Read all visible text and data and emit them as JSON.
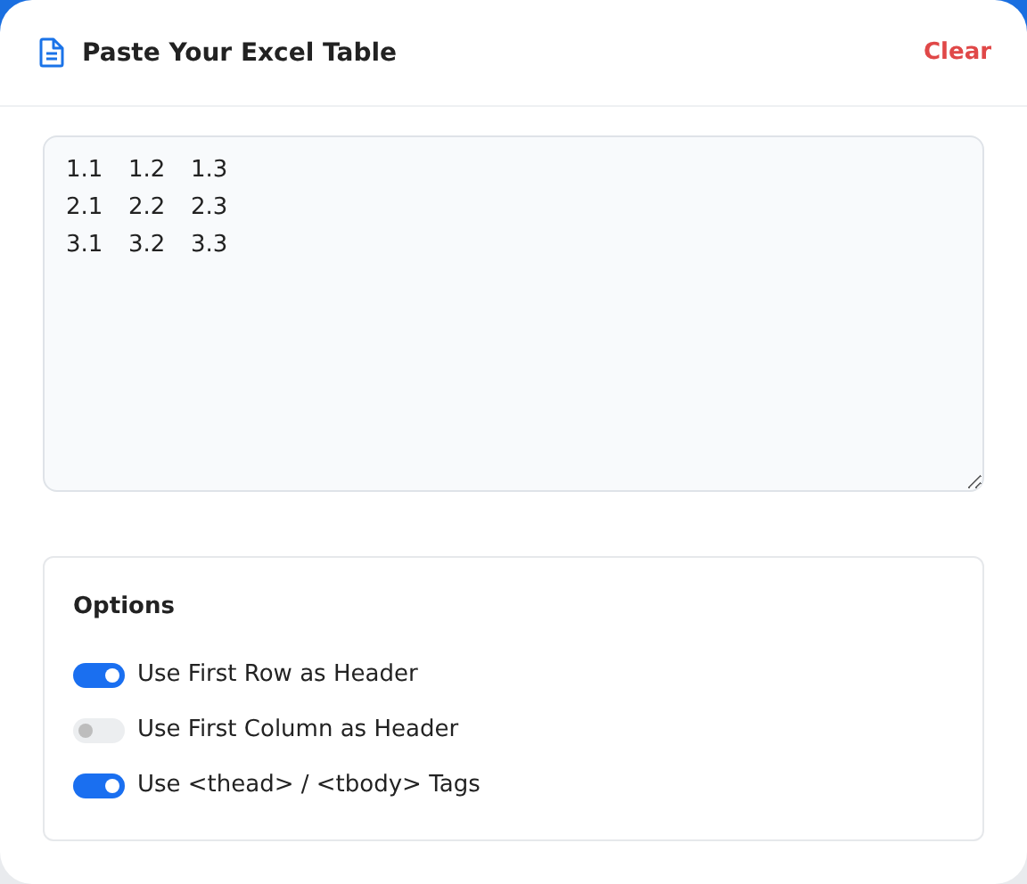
{
  "header": {
    "title": "Paste Your Excel Table",
    "clear_button": "Clear"
  },
  "input": {
    "value": "1.1\t1.2\t1.3\n2.1\t2.2\t2.3\n3.1\t3.2\t3.3"
  },
  "options": {
    "title": "Options",
    "items": [
      {
        "label": "Use First Row as Header",
        "on": true
      },
      {
        "label": "Use First Column as Header",
        "on": false
      },
      {
        "label": "Use <thead> / <tbody> Tags",
        "on": true
      }
    ]
  }
}
